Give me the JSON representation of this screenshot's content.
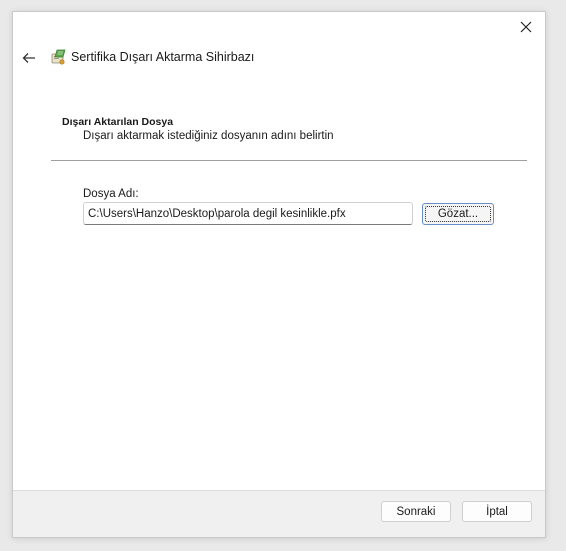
{
  "window": {
    "title": "Sertifika Dışarı Aktarma Sihirbazı",
    "close_icon": "close-icon",
    "back_icon": "back-arrow-icon",
    "app_icon": "certificate-wizard-icon"
  },
  "section": {
    "title": "Dışarı Aktarılan Dosya",
    "subtitle": "Dışarı aktarmak istediğiniz dosyanın adını belirtin"
  },
  "form": {
    "filename_label": "Dosya Adı:",
    "filename_value": "C:\\Users\\Hanzo\\Desktop\\parola degil kesinlikle.pfx",
    "browse_label": "Gözat..."
  },
  "footer": {
    "next_label": "Sonraki",
    "cancel_label": "İptal"
  },
  "colors": {
    "accent": "#6a8fc6",
    "background": "#ffffff",
    "footer": "#f0f0f0"
  }
}
